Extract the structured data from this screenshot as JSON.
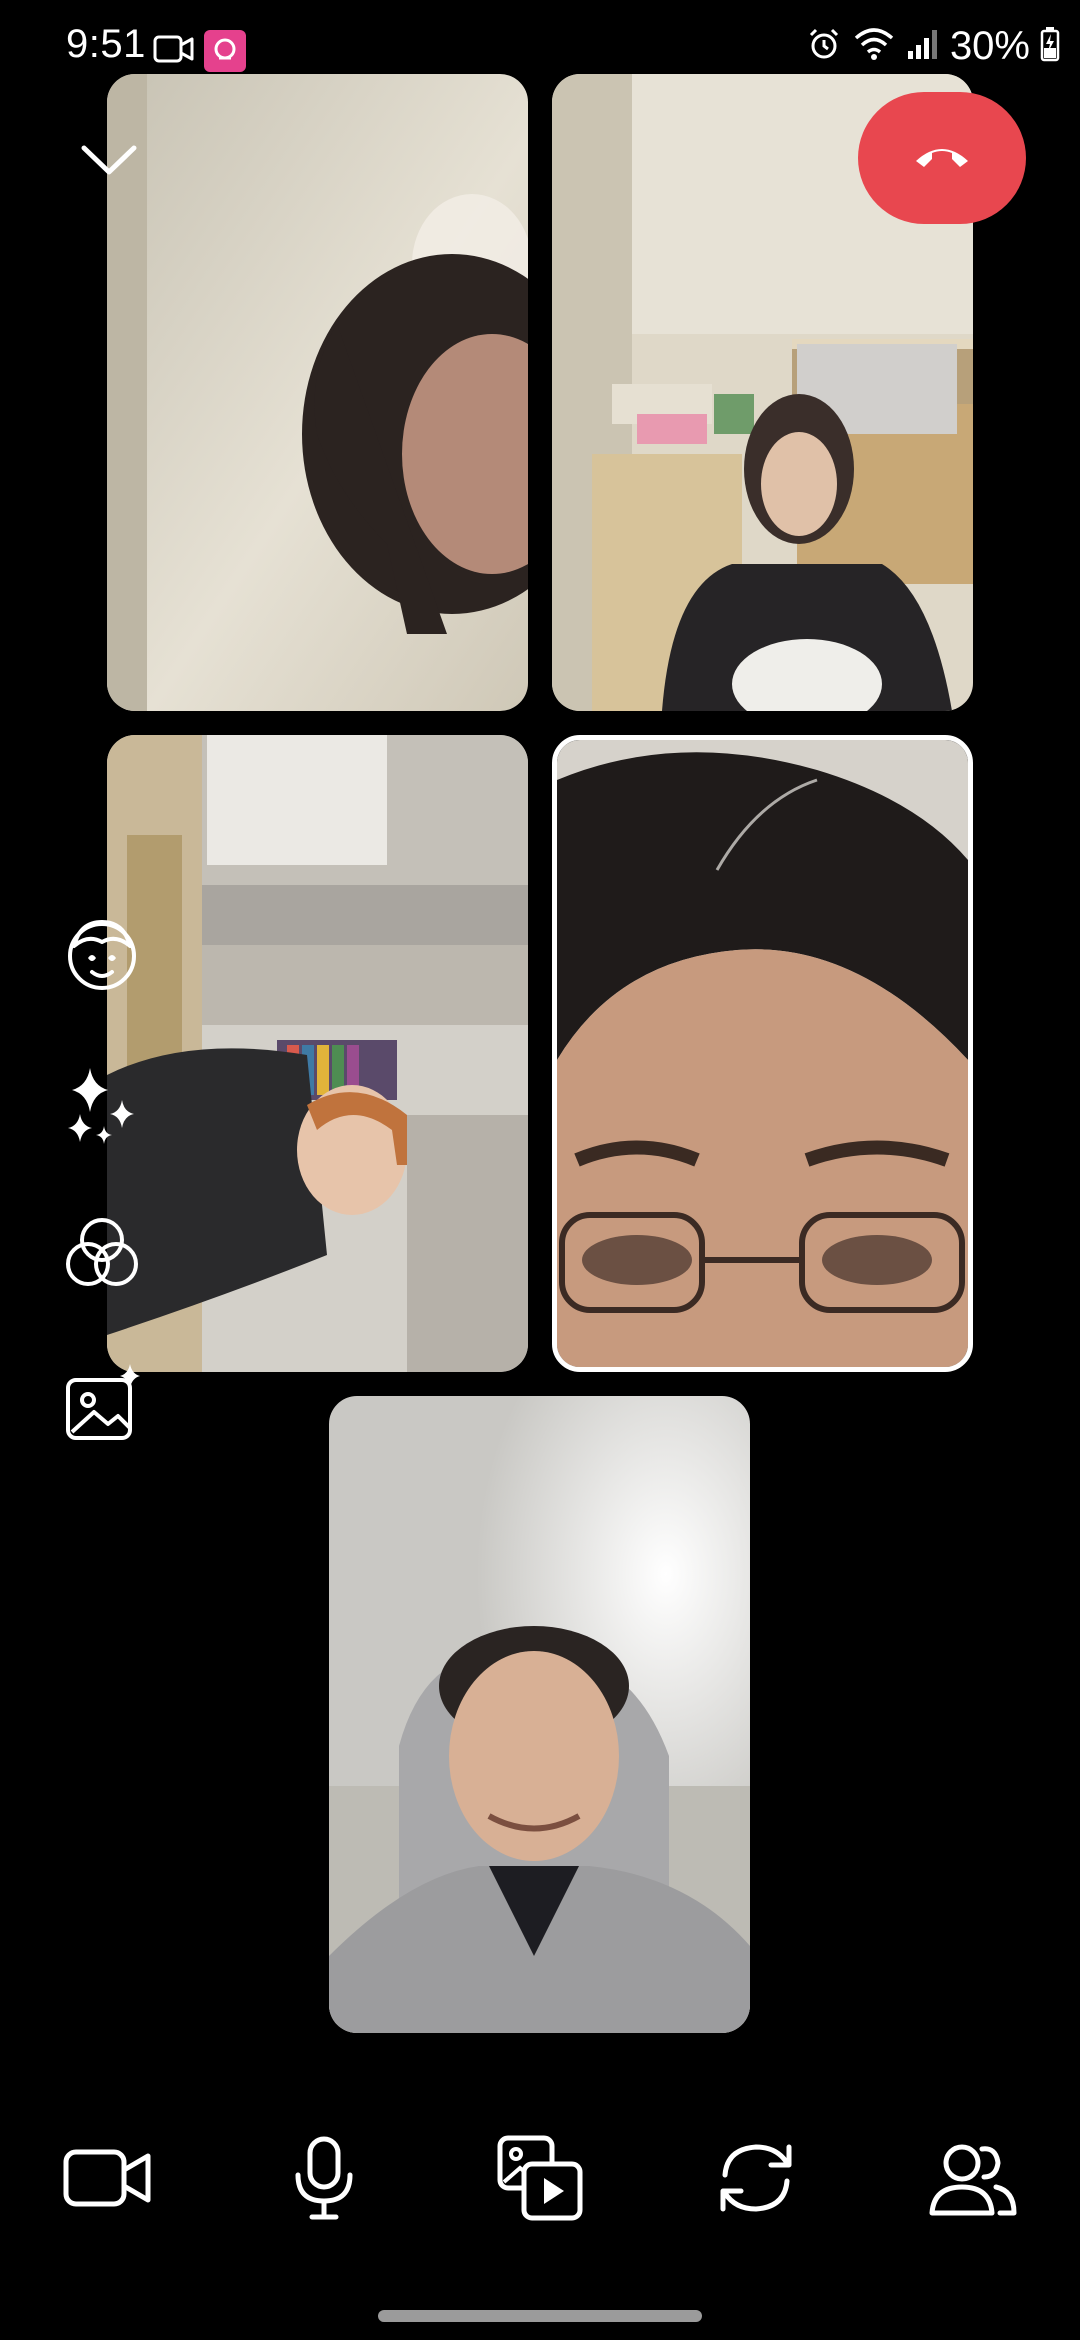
{
  "status_bar": {
    "time": "9:51",
    "battery": "30%",
    "icons": [
      "video-camera-icon",
      "app-notification-icon",
      "alarm-icon",
      "wifi-icon",
      "signal-icon",
      "battery-charging-icon"
    ]
  },
  "call": {
    "participant_tiles": [
      {
        "name": "participant-1",
        "highlighted": false
      },
      {
        "name": "participant-2",
        "highlighted": false
      },
      {
        "name": "participant-3",
        "highlighted": false
      },
      {
        "name": "participant-4",
        "highlighted": true
      },
      {
        "name": "participant-5",
        "highlighted": false
      }
    ],
    "top_controls": [
      "chevron-down-icon",
      "end-call-icon"
    ],
    "side_tools": [
      "face-filter-icon",
      "sparkle-effects-icon",
      "color-filter-icon",
      "background-image-icon"
    ],
    "bottom_controls": [
      "video-camera-icon",
      "microphone-icon",
      "media-share-icon",
      "flip-camera-icon",
      "participants-icon"
    ]
  },
  "colors": {
    "background": "#000000",
    "end_call": "#e8474f",
    "app_badge": "#e5418d",
    "icon": "#ffffff"
  }
}
